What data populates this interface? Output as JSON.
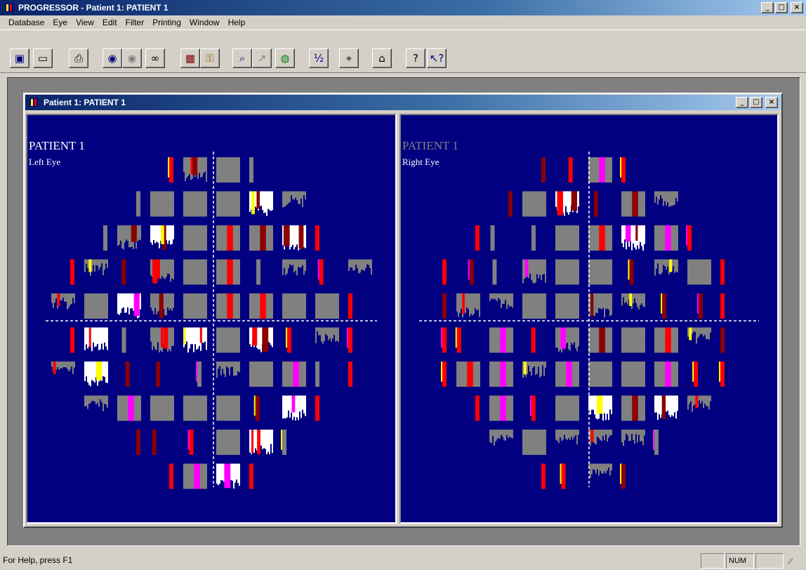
{
  "window": {
    "title": "PROGRESSOR - Patient 1: PATIENT 1"
  },
  "menu": [
    "Database",
    "Eye",
    "View",
    "Edit",
    "Filter",
    "Printing",
    "Window",
    "Help"
  ],
  "toolbar": [
    {
      "name": "database-icon",
      "glyph": "▣",
      "color": "#000080"
    },
    {
      "name": "monitor-icon",
      "glyph": "▭",
      "color": "#000000"
    },
    {
      "name": "printer-icon",
      "glyph": "⎙",
      "color": "#000000"
    },
    {
      "name": "eye-view-icon",
      "glyph": "◉",
      "color": "#000080"
    },
    {
      "name": "eye-gray-icon",
      "glyph": "◉",
      "color": "#808080"
    },
    {
      "name": "binoculars-icon",
      "glyph": "∞",
      "color": "#000000"
    },
    {
      "name": "calendar-icon",
      "glyph": "▦",
      "color": "#800000"
    },
    {
      "name": "key-icon",
      "glyph": "⚿",
      "color": "#806000"
    },
    {
      "name": "magnifier-icon",
      "glyph": "⌕",
      "color": "#000080"
    },
    {
      "name": "chart-icon",
      "glyph": "↗",
      "color": "#808080"
    },
    {
      "name": "globe-icon",
      "glyph": "◍",
      "color": "#008000"
    },
    {
      "name": "half-icon",
      "glyph": "½",
      "color": "#000080"
    },
    {
      "name": "crosshair-icon",
      "glyph": "⌖",
      "color": "#000000"
    },
    {
      "name": "trash-icon",
      "glyph": "⌂",
      "color": "#000000"
    },
    {
      "name": "help-icon",
      "glyph": "?",
      "color": "#000000"
    },
    {
      "name": "context-help-icon",
      "glyph": "↖?",
      "color": "#000080"
    }
  ],
  "child_window": {
    "title": "Patient 1: PATIENT 1"
  },
  "panels": {
    "left": {
      "patient": "PATIENT 1",
      "eye": "Left Eye"
    },
    "right": {
      "patient": "PATIENT 1",
      "eye": "Right Eye"
    }
  },
  "statusbar": {
    "help": "For Help, press F1",
    "num": "NUM"
  },
  "colors": {
    "background": "#000080",
    "gray": "#808080",
    "white": "#ffffff",
    "red": "#ff0000",
    "dark_red": "#8b0000",
    "yellow": "#ffff00",
    "magenta": "#ff00ff"
  }
}
